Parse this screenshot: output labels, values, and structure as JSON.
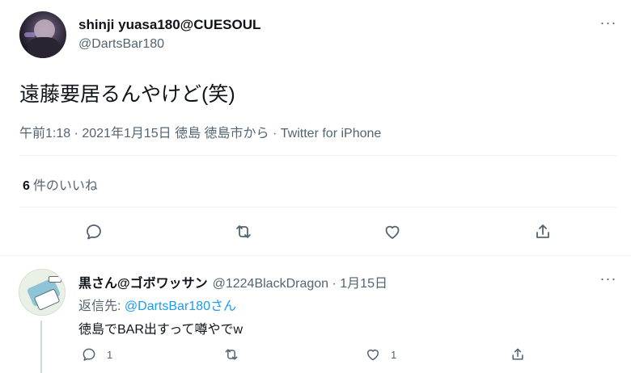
{
  "tweet": {
    "display_name": "shinji yuasa180@CUESOUL",
    "handle": "@DartsBar180",
    "text": "遠藤要居るんやけど(笑)",
    "time": "午前1:18 · 2021年1月15日",
    "location": "徳島 徳島市から",
    "source": "· Twitter for iPhone",
    "likes_count": "6",
    "likes_label": "件のいいね",
    "more_icon": "more-icon"
  },
  "reply": {
    "display_name": "黒さん@ゴボワッサン",
    "handle": "@1224BlackDragon · 1月15日",
    "replying_prefix": "返信先:",
    "replying_mention": "@DartsBar180",
    "replying_suffix": "さん",
    "text": "徳島でBAR出すって噂やでw",
    "reply_count": "1",
    "like_count": "1"
  },
  "colors": {
    "text": "#0f1419",
    "secondary": "#536471",
    "link": "#1d9bf0",
    "divider": "#eff3f4"
  }
}
